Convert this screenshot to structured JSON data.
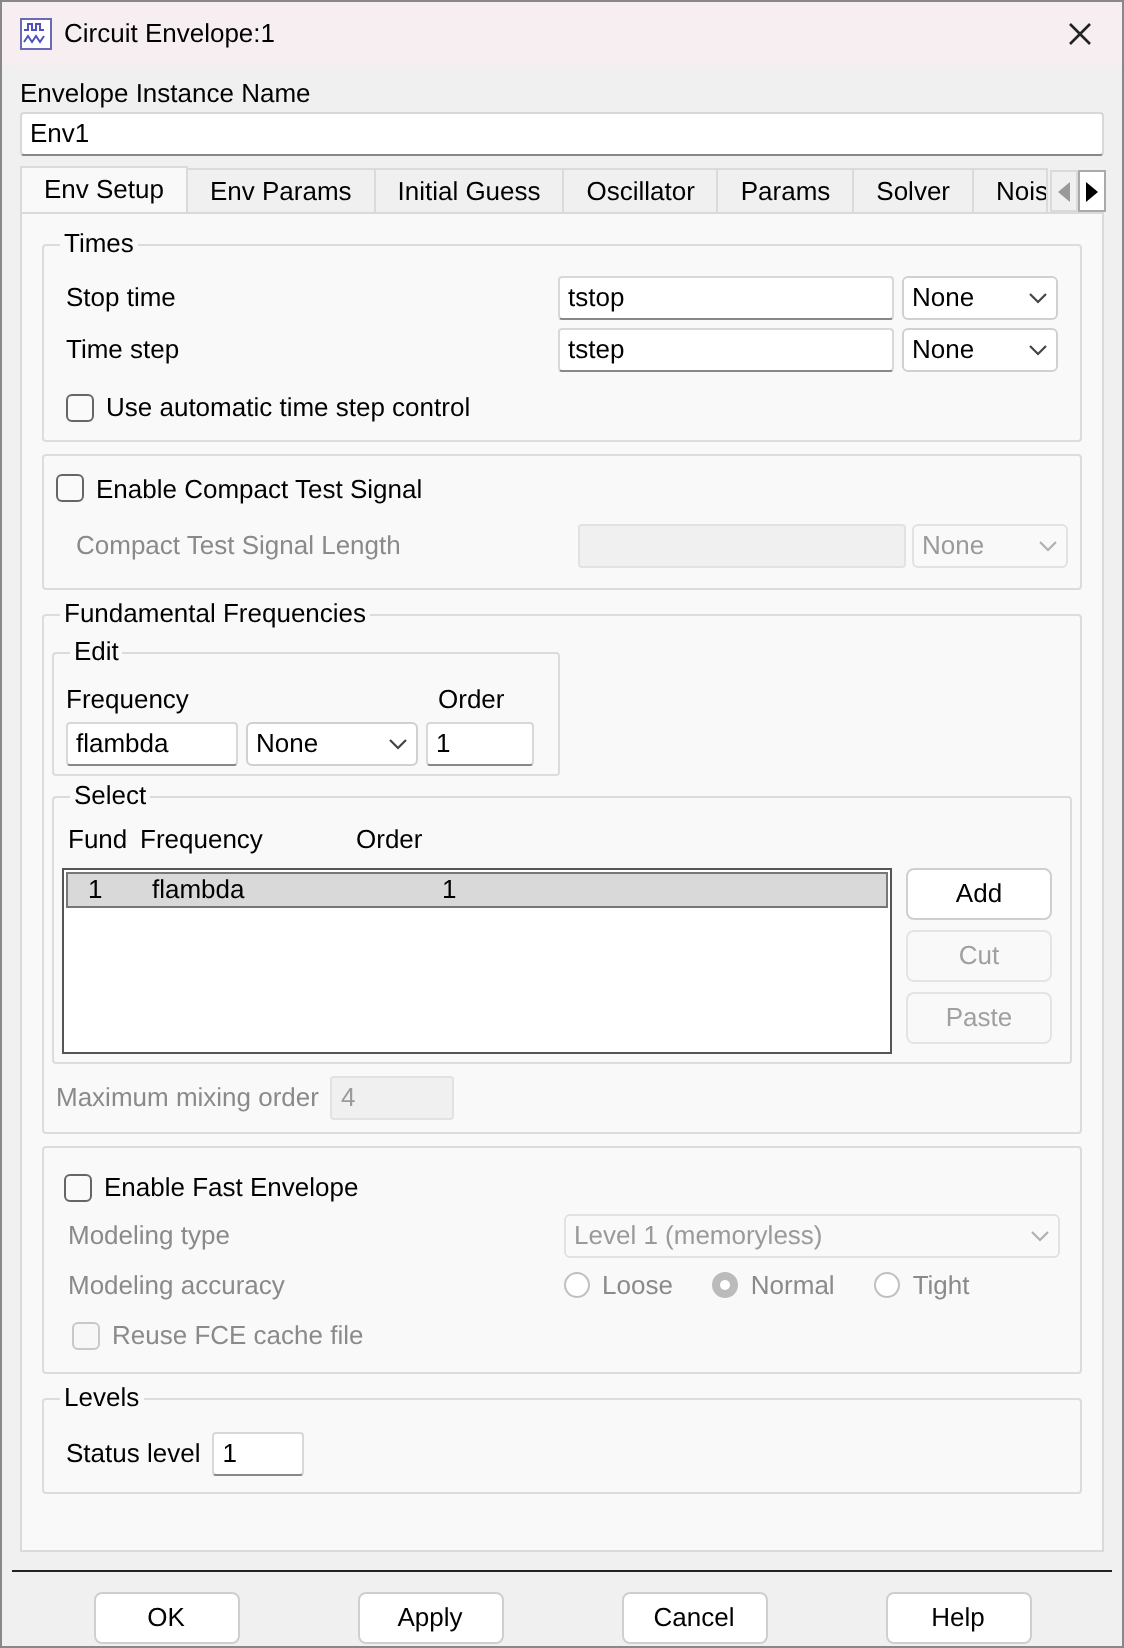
{
  "window": {
    "title": "Circuit Envelope:1"
  },
  "instance_name": {
    "label": "Envelope Instance Name",
    "value": "Env1"
  },
  "tabs": [
    {
      "label": "Env Setup",
      "selected": true
    },
    {
      "label": "Env Params",
      "selected": false
    },
    {
      "label": "Initial Guess",
      "selected": false
    },
    {
      "label": "Oscillator",
      "selected": false
    },
    {
      "label": "Params",
      "selected": false
    },
    {
      "label": "Solver",
      "selected": false
    },
    {
      "label": "Nois",
      "selected": false
    }
  ],
  "times": {
    "title": "Times",
    "rows": [
      {
        "label": "Stop time",
        "value": "tstop",
        "unit": "None"
      },
      {
        "label": "Time step",
        "value": "tstep",
        "unit": "None"
      }
    ],
    "auto_step": {
      "label": "Use automatic time step control",
      "checked": false
    }
  },
  "compact": {
    "checkbox": {
      "label": "Enable Compact Test Signal",
      "checked": false
    },
    "length_label": "Compact Test Signal Length",
    "unit": "None",
    "disabled": true
  },
  "fundamental": {
    "title": "Fundamental Frequencies",
    "edit": {
      "title": "Edit",
      "frequency_label": "Frequency",
      "order_label": "Order",
      "frequency": "flambda",
      "unit": "None",
      "order": "1"
    },
    "select": {
      "title": "Select",
      "columns": [
        "Fund",
        "Frequency",
        "Order"
      ],
      "rows": [
        {
          "fund": "1",
          "frequency": "flambda",
          "order": "1",
          "selected": true
        }
      ],
      "buttons": [
        {
          "label": "Add",
          "disabled": false
        },
        {
          "label": "Cut",
          "disabled": true
        },
        {
          "label": "Paste",
          "disabled": true
        }
      ]
    },
    "max_mixing": {
      "label": "Maximum mixing order",
      "value": "4",
      "disabled": true
    }
  },
  "fast_envelope": {
    "checkbox": {
      "label": "Enable Fast Envelope",
      "checked": false
    },
    "disabled": true,
    "modeling_type": {
      "label": "Modeling type",
      "value": "Level 1 (memoryless)"
    },
    "accuracy": {
      "label": "Modeling accuracy",
      "options": [
        {
          "label": "Loose",
          "selected": false
        },
        {
          "label": "Normal",
          "selected": true
        },
        {
          "label": "Tight",
          "selected": false
        }
      ]
    },
    "reuse": {
      "label": "Reuse FCE cache file",
      "checked": false
    }
  },
  "levels": {
    "title": "Levels",
    "status": {
      "label": "Status level",
      "value": "1"
    }
  },
  "buttons": [
    "OK",
    "Apply",
    "Cancel",
    "Help"
  ]
}
